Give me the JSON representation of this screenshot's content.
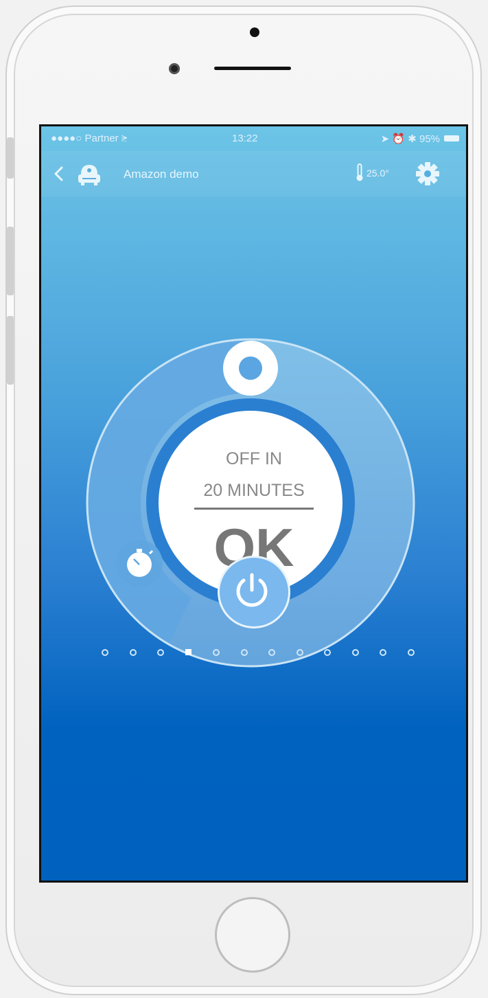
{
  "statusbar": {
    "carrier": "●●●●○ Partner ⪭",
    "time": "13:22",
    "battery": "➤ ⏰ ✱ 95%"
  },
  "navbar": {
    "title": "Amazon demo",
    "temperature": "25.0°"
  },
  "timer": {
    "line1": "OFF IN",
    "line2": "20 MINUTES",
    "confirm": "OK"
  },
  "pager": {
    "count": 12,
    "active_index": 3
  },
  "colors": {
    "accent": "#2a7fd1",
    "ring_light": "#a8d1ef",
    "ring_mid": "#5fa6e0",
    "power_button": "#7ab8ee"
  },
  "icons": [
    "back-icon",
    "device-icon",
    "thermometer-icon",
    "gear-icon",
    "timer-knob",
    "stopwatch-icon",
    "power-icon",
    "home-button"
  ]
}
